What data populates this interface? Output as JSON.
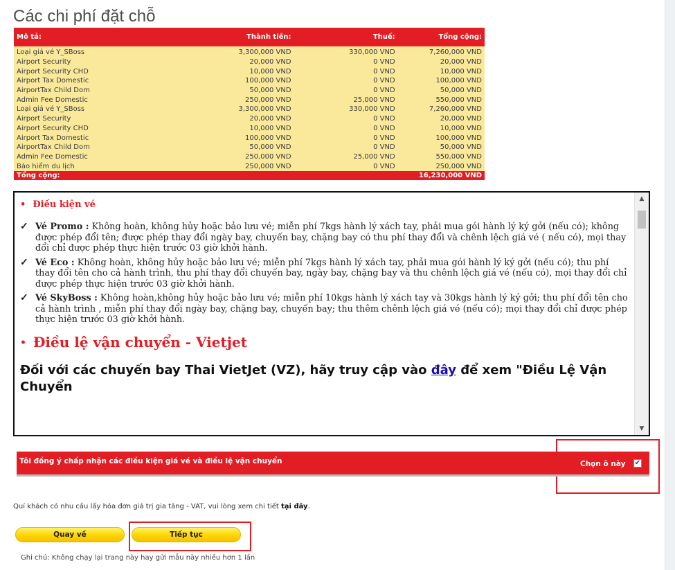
{
  "page": {
    "title": "Các chi phí đặt chỗ"
  },
  "costs": {
    "headers": {
      "desc": "Mô tả:",
      "amount": "Thành tiền:",
      "tax": "Thuế:",
      "total": "Tổng cộng:"
    },
    "rows": [
      {
        "desc": "Loại giá vé Y_SBoss",
        "amount": "3,300,000 VND",
        "tax": "330,000 VND",
        "total": "7,260,000 VND"
      },
      {
        "desc": "Airport Security",
        "amount": "20,000 VND",
        "tax": "0 VND",
        "total": "20,000 VND"
      },
      {
        "desc": "Airport Security CHD",
        "amount": "10,000 VND",
        "tax": "0 VND",
        "total": "10,000 VND"
      },
      {
        "desc": "Airport Tax Domestic",
        "amount": "100,000 VND",
        "tax": "0 VND",
        "total": "100,000 VND"
      },
      {
        "desc": "AirportTax Child Dom",
        "amount": "50,000 VND",
        "tax": "0 VND",
        "total": "50,000 VND"
      },
      {
        "desc": "Admin Fee Domestic",
        "amount": "250,000 VND",
        "tax": "25,000 VND",
        "total": "550,000 VND"
      },
      {
        "desc": "Loại giá vé Y_SBoss",
        "amount": "3,300,000 VND",
        "tax": "330,000 VND",
        "total": "7,260,000 VND"
      },
      {
        "desc": "Airport Security",
        "amount": "20,000 VND",
        "tax": "0 VND",
        "total": "20,000 VND"
      },
      {
        "desc": "Airport Security CHD",
        "amount": "10,000 VND",
        "tax": "0 VND",
        "total": "10,000 VND"
      },
      {
        "desc": "Airport Tax Domestic",
        "amount": "100,000 VND",
        "tax": "0 VND",
        "total": "100,000 VND"
      },
      {
        "desc": "AirportTax Child Dom",
        "amount": "50,000 VND",
        "tax": "0 VND",
        "total": "50,000 VND"
      },
      {
        "desc": "Admin Fee Domestic",
        "amount": "250,000 VND",
        "tax": "25,000 VND",
        "total": "550,000 VND"
      },
      {
        "desc": "Bảo hiểm du lịch",
        "amount": "250,000 VND",
        "tax": "0 VND",
        "total": "250,000 VND"
      }
    ],
    "total_label": "Tổng cộng:",
    "grand_total": "16,230,000 VND"
  },
  "conditions": {
    "ticket_heading": "Điều kiện vé",
    "items": [
      {
        "name": "Vé Promo :",
        "text": " Không hoàn, không hủy hoặc bảo lưu vé; miễn phí 7kgs hành lý xách tay, phải mua gói hành lý ký gởi (nếu có); không được phép đổi tên; được phép thay đổi ngày bay, chuyến bay, chặng bay có thu phí thay đổi và chênh lệch giá vé ( nếu có), mọi thay đổi chỉ được phép thực hiện trước 03 giờ khởi hành."
      },
      {
        "name": "Vé Eco :",
        "text": " Không hoàn, không hủy hoặc bảo lưu vé; miễn phí 7kgs hành lý xách tay, phải mua gói hành lý ký gởi (nếu có); thu phí thay đổi tên cho cả hành trình, thu phí thay đổi chuyến bay, ngày bay, chặng bay và thu chênh lệch giá vé (nếu có), mọi thay đổi chỉ được phép thực hiện trước 03 giờ khởi hành."
      },
      {
        "name": "Vé SkyBoss :",
        "text": " Không hoàn,không hủy hoặc bảo lưu vé; miễn phí 10kgs hành lý xách tay và 30kgs hành lý ký gởi; thu phí đổi tên cho cả hành trình , miễn phí thay đổi ngày bay, chặng bay, chuyến bay; thu thêm chênh lệch giá vé (nếu có); mọi thay đổi chỉ được phép thực hiện trước 03 giờ khởi hành."
      }
    ],
    "carriage_heading": "Điều lệ vận chuyển - Vietjet",
    "vz_before": "Đối với các chuyến bay Thai VietJet (VZ), hãy truy cập vào ",
    "vz_link": "đây",
    "vz_after": " để xem \"Điều Lệ Vận Chuyển"
  },
  "agree": {
    "text": "Tôi đồng ý chấp nhận các điều kiện giá vé và điều lệ vận chuyển",
    "checkbox_label": "Chọn ô này",
    "checked": true
  },
  "vat": {
    "text": "Quí khách có nhu cầu lấy hóa đơn giá trị gia tăng - VAT, vui lòng xem chi tiết ",
    "link": "tại đây",
    "end": "."
  },
  "buttons": {
    "back": "Quay về",
    "next": "Tiếp tục"
  },
  "footnote": "Ghi chú: Không chạy lại trang này hay gửi mẫu này nhiều hơn 1 lần",
  "colors": {
    "brand_red": "#e21d24",
    "table_yellow": "#fbe99b",
    "button_yellow": "#ffd400"
  }
}
